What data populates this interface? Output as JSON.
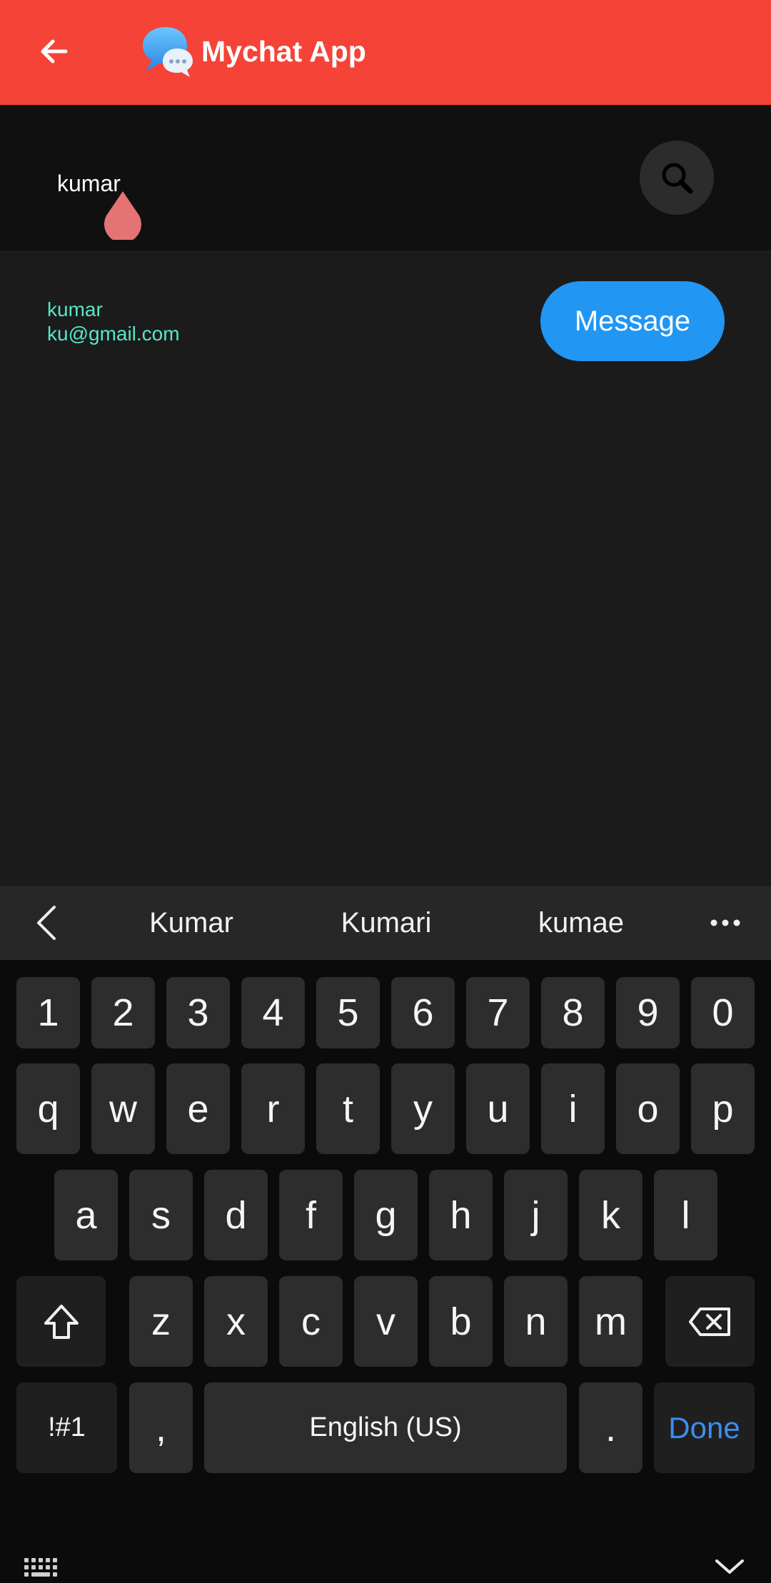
{
  "app": {
    "title": "Mychat App",
    "brand_color": "#f54337",
    "icons": {
      "back": "arrow-left-icon",
      "logo": "chat-bubbles-logo"
    }
  },
  "search": {
    "value": "kumar",
    "button_icon": "search-icon"
  },
  "results": [
    {
      "name": "kumar",
      "email": "ku@gmail.com",
      "action_label": "Message"
    }
  ],
  "keyboard": {
    "suggestions": [
      "Kumar",
      "Kumari",
      "kumae"
    ],
    "rows": {
      "numbers": [
        "1",
        "2",
        "3",
        "4",
        "5",
        "6",
        "7",
        "8",
        "9",
        "0"
      ],
      "row1": [
        "q",
        "w",
        "e",
        "r",
        "t",
        "y",
        "u",
        "i",
        "o",
        "p"
      ],
      "row2": [
        "a",
        "s",
        "d",
        "f",
        "g",
        "h",
        "j",
        "k",
        "l"
      ],
      "row3": [
        "z",
        "x",
        "c",
        "v",
        "b",
        "n",
        "m"
      ]
    },
    "symbols_label": "!#1",
    "comma_label": ",",
    "space_label": "English (US)",
    "period_label": ".",
    "done_label": "Done",
    "done_color": "#3b8ef0"
  }
}
